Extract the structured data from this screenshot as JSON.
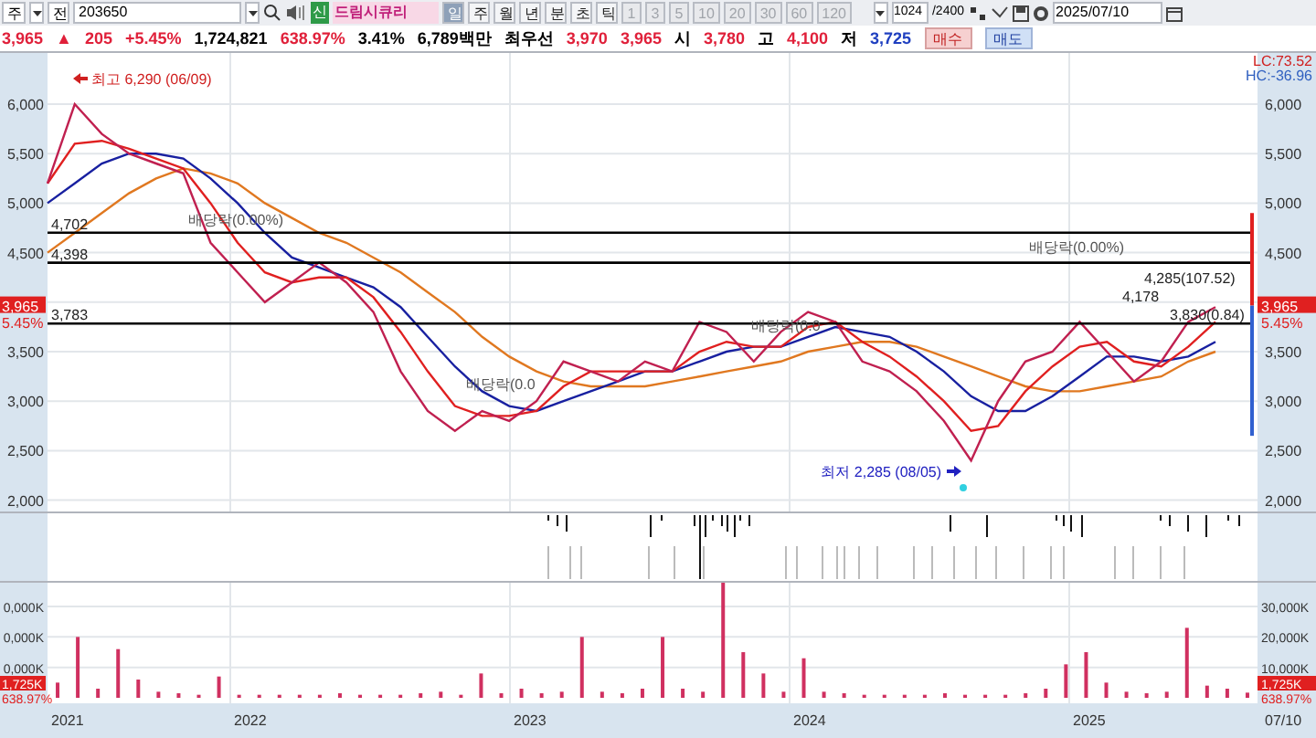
{
  "toolbar": {
    "market_select": "주",
    "exchange_button": "전",
    "code_field": "203650",
    "new_badge": "신",
    "stock_name": "드림시큐리",
    "periods": [
      {
        "label": "일",
        "selected": true
      },
      {
        "label": "주",
        "selected": false
      },
      {
        "label": "월",
        "selected": false
      },
      {
        "label": "년",
        "selected": false
      },
      {
        "label": "분",
        "selected": false
      },
      {
        "label": "초",
        "selected": false
      },
      {
        "label": "틱",
        "selected": false
      }
    ],
    "intervals": [
      {
        "label": "1",
        "disabled": true
      },
      {
        "label": "3",
        "disabled": true
      },
      {
        "label": "5",
        "disabled": true
      },
      {
        "label": "10",
        "disabled": true
      },
      {
        "label": "20",
        "disabled": true
      },
      {
        "label": "30",
        "disabled": true
      },
      {
        "label": "60",
        "disabled": true
      },
      {
        "label": "120",
        "disabled": true
      }
    ],
    "count_field": "1024",
    "count_total": "/2400",
    "date_field": "2025/07/10"
  },
  "quote": [
    {
      "text": "3,965",
      "color": "#e0203a"
    },
    {
      "text": "▲",
      "color": "#e0203a"
    },
    {
      "text": "205",
      "color": "#e0203a"
    },
    {
      "text": "+5.45%",
      "color": "#e0203a"
    },
    {
      "text": "1,724,821",
      "color": "#000000"
    },
    {
      "text": "638.97%",
      "color": "#e0203a"
    },
    {
      "text": "3.41%",
      "color": "#000000"
    },
    {
      "text": "6,789백만",
      "color": "#000000"
    },
    {
      "text": "최우선",
      "color": "#000000"
    },
    {
      "text": "3,970",
      "color": "#e0203a"
    },
    {
      "text": "3,965",
      "color": "#e0203a"
    },
    {
      "text": "시",
      "color": "#000000"
    },
    {
      "text": "3,780",
      "color": "#e0203a"
    },
    {
      "text": "고",
      "color": "#000000"
    },
    {
      "text": "4,100",
      "color": "#e0203a"
    },
    {
      "text": "저",
      "color": "#000000"
    },
    {
      "text": "3,725",
      "color": "#2040c0"
    }
  ],
  "buy_button": "매수",
  "sell_button": "매도",
  "price_panel": {
    "indicators": [
      "LC:73.52",
      "HC:-36.96"
    ],
    "left_tag": {
      "price": "3,965",
      "change": "5.45%"
    },
    "right_tag": {
      "price": "3,965",
      "change": "5.45%"
    },
    "labels": [
      {
        "kind": "high",
        "text": "최고 6,290 (06/09)"
      },
      {
        "kind": "low",
        "text": "최저 2,285 (08/05)"
      },
      {
        "kind": "dividend",
        "text": "배당락(0.00%)"
      },
      {
        "kind": "dividend",
        "text": "배당락(0.0"
      },
      {
        "kind": "dividend",
        "text": "배당락(0.0"
      },
      {
        "kind": "dividend",
        "text": "배당락(0.00%)"
      },
      {
        "kind": "value",
        "text": "4,285(107.52)"
      },
      {
        "kind": "value",
        "text": "4,178"
      },
      {
        "kind": "value",
        "text": "3,830(0.84)"
      }
    ],
    "chart_data": {
      "type": "line",
      "categories": [
        null,
        null,
        null,
        null,
        null,
        null,
        null,
        null,
        null,
        null,
        null,
        null,
        null,
        null,
        null,
        null,
        null,
        null,
        null,
        null,
        null,
        null,
        null,
        null,
        null,
        null,
        null,
        null,
        null,
        null,
        null,
        null,
        null,
        null,
        null,
        null,
        null,
        null,
        null,
        null,
        null,
        null,
        null,
        null
      ],
      "series": [
        {
          "color": "#c02050",
          "values": [
            5200,
            6000,
            5700,
            5500,
            5400,
            5300,
            4600,
            4300,
            4000,
            4200,
            4400,
            4200,
            3900,
            3300,
            2900,
            2700,
            2900,
            2800,
            3000,
            3400,
            3300,
            3200,
            3400,
            3300,
            3800,
            3700,
            3400,
            3700,
            3900,
            3800,
            3400,
            3300,
            3100,
            2800,
            2400,
            3000,
            3400,
            3500,
            3800,
            3500,
            3200,
            3400,
            3800,
            3950
          ]
        },
        {
          "color": "#e02020",
          "values": [
            5200,
            5600,
            5630,
            5550,
            5450,
            5350,
            5000,
            4600,
            4300,
            4200,
            4250,
            4250,
            4050,
            3700,
            3300,
            2950,
            2850,
            2850,
            2900,
            3150,
            3300,
            3300,
            3300,
            3300,
            3500,
            3600,
            3550,
            3550,
            3750,
            3800,
            3600,
            3450,
            3250,
            3000,
            2700,
            2750,
            3100,
            3350,
            3550,
            3600,
            3400,
            3350,
            3550,
            3800
          ]
        },
        {
          "color": "#1820a0",
          "values": [
            5000,
            5200,
            5400,
            5500,
            5500,
            5450,
            5250,
            5000,
            4700,
            4450,
            4350,
            4250,
            4150,
            3950,
            3650,
            3350,
            3100,
            2950,
            2900,
            3000,
            3100,
            3200,
            3300,
            3300,
            3400,
            3500,
            3550,
            3550,
            3650,
            3750,
            3700,
            3650,
            3500,
            3300,
            3050,
            2900,
            2900,
            3050,
            3250,
            3450,
            3450,
            3400,
            3450,
            3600
          ]
        },
        {
          "color": "#e07820",
          "values": [
            4500,
            4700,
            4900,
            5100,
            5250,
            5350,
            5300,
            5200,
            5000,
            4850,
            4700,
            4600,
            4450,
            4300,
            4100,
            3900,
            3650,
            3450,
            3300,
            3200,
            3150,
            3150,
            3150,
            3200,
            3250,
            3300,
            3350,
            3400,
            3500,
            3550,
            3600,
            3600,
            3550,
            3450,
            3350,
            3250,
            3150,
            3100,
            3100,
            3150,
            3200,
            3250,
            3400,
            3500
          ]
        }
      ],
      "ylim": [
        2000,
        6000
      ],
      "grid": true,
      "yticks": [
        {
          "value": 2000,
          "label": "2,000"
        },
        {
          "value": 2500,
          "label": "2,500"
        },
        {
          "value": 3000,
          "label": "3,000"
        },
        {
          "value": 3500,
          "label": "3,500"
        },
        {
          "value": 4500,
          "label": "4,500"
        },
        {
          "value": 5000,
          "label": "5,000"
        },
        {
          "value": 5500,
          "label": "5,500"
        },
        {
          "value": 6000,
          "label": "6,000"
        }
      ],
      "ref_lines": [
        {
          "axis": "y",
          "value": 4702,
          "label": "4,702"
        },
        {
          "axis": "y",
          "value": 4398,
          "label": "4,398"
        },
        {
          "axis": "y",
          "value": 3783,
          "label": "3,783"
        }
      ]
    }
  },
  "volume_panel": {
    "left_tag": {
      "volume": "1,725K",
      "change": "638.97%"
    },
    "right_tag": {
      "volume": "1,725K",
      "change": "638.97%"
    },
    "left_axis_labels": [
      "0,000K",
      "0,000K",
      "0,000K"
    ],
    "chart_data": {
      "type": "bar",
      "categories": [
        null,
        null,
        null,
        null,
        null,
        null,
        null,
        null,
        null,
        null,
        null,
        null,
        null,
        null,
        null,
        null,
        null,
        null,
        null,
        null,
        null,
        null,
        null,
        null,
        null,
        null,
        null,
        null,
        null,
        null,
        null,
        null,
        null,
        null,
        null,
        null,
        null,
        null,
        null,
        null,
        null,
        null,
        null,
        null,
        null,
        null,
        null,
        null,
        null,
        null,
        null,
        null,
        null,
        null,
        null,
        null,
        null,
        null,
        null,
        null
      ],
      "series": [
        {
          "color": "#d03060",
          "values": [
            5000,
            20000,
            3000,
            16000,
            6000,
            2000,
            1500,
            1000,
            7000,
            1000,
            1000,
            1000,
            1000,
            1000,
            1500,
            1000,
            1000,
            1000,
            1500,
            2000,
            1000,
            8000,
            1500,
            3000,
            1500,
            2000,
            20000,
            2000,
            1500,
            3000,
            20000,
            3000,
            2000,
            38000,
            15000,
            8000,
            2000,
            13000,
            2000,
            1500,
            1000,
            1000,
            1000,
            1000,
            1500,
            1000,
            1000,
            1000,
            1500,
            3000,
            11000,
            15000,
            5000,
            2000,
            1500,
            2000,
            23000,
            4000,
            3000,
            1700
          ]
        }
      ],
      "ylim": [
        0,
        38000
      ],
      "grid": true,
      "yticks": [
        {
          "value": 10000,
          "label": "10,000K"
        },
        {
          "value": 20000,
          "label": "20,000K"
        },
        {
          "value": 30000,
          "label": "30,000K"
        }
      ]
    }
  },
  "date_axis": [
    "2021",
    "2022",
    "2023",
    "2024",
    "2025"
  ],
  "end_date": "07/10"
}
